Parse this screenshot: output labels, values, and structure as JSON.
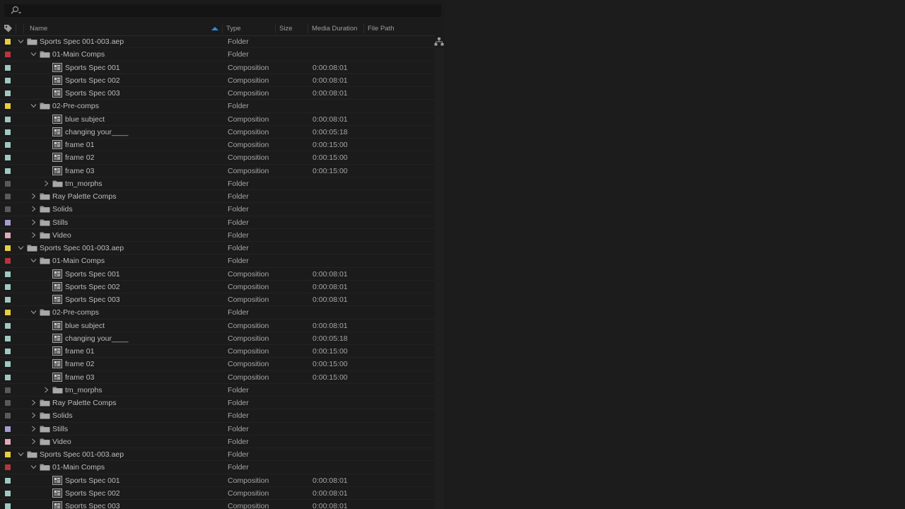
{
  "search": {
    "placeholder": ""
  },
  "columns": {
    "name": "Name",
    "type": "Type",
    "size": "Size",
    "media_duration": "Media Duration",
    "file_path": "File Path"
  },
  "label_colors": {
    "yellow": "#e6cf3d",
    "red": "#b8353a",
    "aqua": "#9ec9c2",
    "gray": "#5a5a5a",
    "lavender": "#a59cd2",
    "pink": "#e5a8b8"
  },
  "accent": "#2d8ceb",
  "rows": [
    {
      "label": "yellow",
      "depth": 0,
      "twirl": "open",
      "icon": "folder",
      "name": "Sports Spec 001-003.aep",
      "type": "Folder",
      "duration": ""
    },
    {
      "label": "red",
      "depth": 1,
      "twirl": "open",
      "icon": "folder",
      "name": "01-Main Comps",
      "type": "Folder",
      "duration": ""
    },
    {
      "label": "aqua",
      "depth": 2,
      "twirl": "none",
      "icon": "composition",
      "name": "Sports Spec 001",
      "type": "Composition",
      "duration": "0:00:08:01"
    },
    {
      "label": "aqua",
      "depth": 2,
      "twirl": "none",
      "icon": "composition",
      "name": "Sports Spec 002",
      "type": "Composition",
      "duration": "0:00:08:01"
    },
    {
      "label": "aqua",
      "depth": 2,
      "twirl": "none",
      "icon": "composition",
      "name": "Sports Spec 003",
      "type": "Composition",
      "duration": "0:00:08:01"
    },
    {
      "label": "yellow",
      "depth": 1,
      "twirl": "open",
      "icon": "folder",
      "name": "02-Pre-comps",
      "type": "Folder",
      "duration": ""
    },
    {
      "label": "aqua",
      "depth": 2,
      "twirl": "none",
      "icon": "composition",
      "name": "blue subject",
      "type": "Composition",
      "duration": "0:00:08:01"
    },
    {
      "label": "aqua",
      "depth": 2,
      "twirl": "none",
      "icon": "composition",
      "name": "changing your____",
      "type": "Composition",
      "duration": "0:00:05:18"
    },
    {
      "label": "aqua",
      "depth": 2,
      "twirl": "none",
      "icon": "composition",
      "name": "frame 01",
      "type": "Composition",
      "duration": "0:00:15:00"
    },
    {
      "label": "aqua",
      "depth": 2,
      "twirl": "none",
      "icon": "composition",
      "name": "frame 02",
      "type": "Composition",
      "duration": "0:00:15:00"
    },
    {
      "label": "aqua",
      "depth": 2,
      "twirl": "none",
      "icon": "composition",
      "name": "frame 03",
      "type": "Composition",
      "duration": "0:00:15:00"
    },
    {
      "label": "gray",
      "depth": 2,
      "twirl": "closed",
      "icon": "folder",
      "name": "tm_morphs",
      "type": "Folder",
      "duration": ""
    },
    {
      "label": "gray",
      "depth": 1,
      "twirl": "closed",
      "icon": "folder",
      "name": "Ray Palette Comps",
      "type": "Folder",
      "duration": ""
    },
    {
      "label": "gray",
      "depth": 1,
      "twirl": "closed",
      "icon": "folder",
      "name": "Solids",
      "type": "Folder",
      "duration": ""
    },
    {
      "label": "lavender",
      "depth": 1,
      "twirl": "closed",
      "icon": "folder",
      "name": "Stills",
      "type": "Folder",
      "duration": ""
    },
    {
      "label": "pink",
      "depth": 1,
      "twirl": "closed",
      "icon": "folder",
      "name": "Video",
      "type": "Folder",
      "duration": ""
    },
    {
      "label": "yellow",
      "depth": 0,
      "twirl": "open",
      "icon": "folder",
      "name": "Sports Spec 001-003.aep",
      "type": "Folder",
      "duration": ""
    },
    {
      "label": "red",
      "depth": 1,
      "twirl": "open",
      "icon": "folder",
      "name": "01-Main Comps",
      "type": "Folder",
      "duration": ""
    },
    {
      "label": "aqua",
      "depth": 2,
      "twirl": "none",
      "icon": "composition",
      "name": "Sports Spec 001",
      "type": "Composition",
      "duration": "0:00:08:01"
    },
    {
      "label": "aqua",
      "depth": 2,
      "twirl": "none",
      "icon": "composition",
      "name": "Sports Spec 002",
      "type": "Composition",
      "duration": "0:00:08:01"
    },
    {
      "label": "aqua",
      "depth": 2,
      "twirl": "none",
      "icon": "composition",
      "name": "Sports Spec 003",
      "type": "Composition",
      "duration": "0:00:08:01"
    },
    {
      "label": "yellow",
      "depth": 1,
      "twirl": "open",
      "icon": "folder",
      "name": "02-Pre-comps",
      "type": "Folder",
      "duration": ""
    },
    {
      "label": "aqua",
      "depth": 2,
      "twirl": "none",
      "icon": "composition",
      "name": "blue subject",
      "type": "Composition",
      "duration": "0:00:08:01"
    },
    {
      "label": "aqua",
      "depth": 2,
      "twirl": "none",
      "icon": "composition",
      "name": "changing your____",
      "type": "Composition",
      "duration": "0:00:05:18"
    },
    {
      "label": "aqua",
      "depth": 2,
      "twirl": "none",
      "icon": "composition",
      "name": "frame 01",
      "type": "Composition",
      "duration": "0:00:15:00"
    },
    {
      "label": "aqua",
      "depth": 2,
      "twirl": "none",
      "icon": "composition",
      "name": "frame 02",
      "type": "Composition",
      "duration": "0:00:15:00"
    },
    {
      "label": "aqua",
      "depth": 2,
      "twirl": "none",
      "icon": "composition",
      "name": "frame 03",
      "type": "Composition",
      "duration": "0:00:15:00"
    },
    {
      "label": "gray",
      "depth": 2,
      "twirl": "closed",
      "icon": "folder",
      "name": "tm_morphs",
      "type": "Folder",
      "duration": ""
    },
    {
      "label": "gray",
      "depth": 1,
      "twirl": "closed",
      "icon": "folder",
      "name": "Ray Palette Comps",
      "type": "Folder",
      "duration": ""
    },
    {
      "label": "gray",
      "depth": 1,
      "twirl": "closed",
      "icon": "folder",
      "name": "Solids",
      "type": "Folder",
      "duration": ""
    },
    {
      "label": "lavender",
      "depth": 1,
      "twirl": "closed",
      "icon": "folder",
      "name": "Stills",
      "type": "Folder",
      "duration": ""
    },
    {
      "label": "pink",
      "depth": 1,
      "twirl": "closed",
      "icon": "folder",
      "name": "Video",
      "type": "Folder",
      "duration": ""
    },
    {
      "label": "yellow",
      "depth": 0,
      "twirl": "open",
      "icon": "folder",
      "name": "Sports Spec 001-003.aep",
      "type": "Folder",
      "duration": ""
    },
    {
      "label": "red",
      "depth": 1,
      "twirl": "open",
      "icon": "folder",
      "name": "01-Main Comps",
      "type": "Folder",
      "duration": ""
    },
    {
      "label": "aqua",
      "depth": 2,
      "twirl": "none",
      "icon": "composition",
      "name": "Sports Spec 001",
      "type": "Composition",
      "duration": "0:00:08:01"
    },
    {
      "label": "aqua",
      "depth": 2,
      "twirl": "none",
      "icon": "composition",
      "name": "Sports Spec 002",
      "type": "Composition",
      "duration": "0:00:08:01"
    },
    {
      "label": "aqua",
      "depth": 2,
      "twirl": "none",
      "icon": "composition",
      "name": "Sports Spec 003",
      "type": "Composition",
      "duration": "0:00:08:01"
    }
  ]
}
